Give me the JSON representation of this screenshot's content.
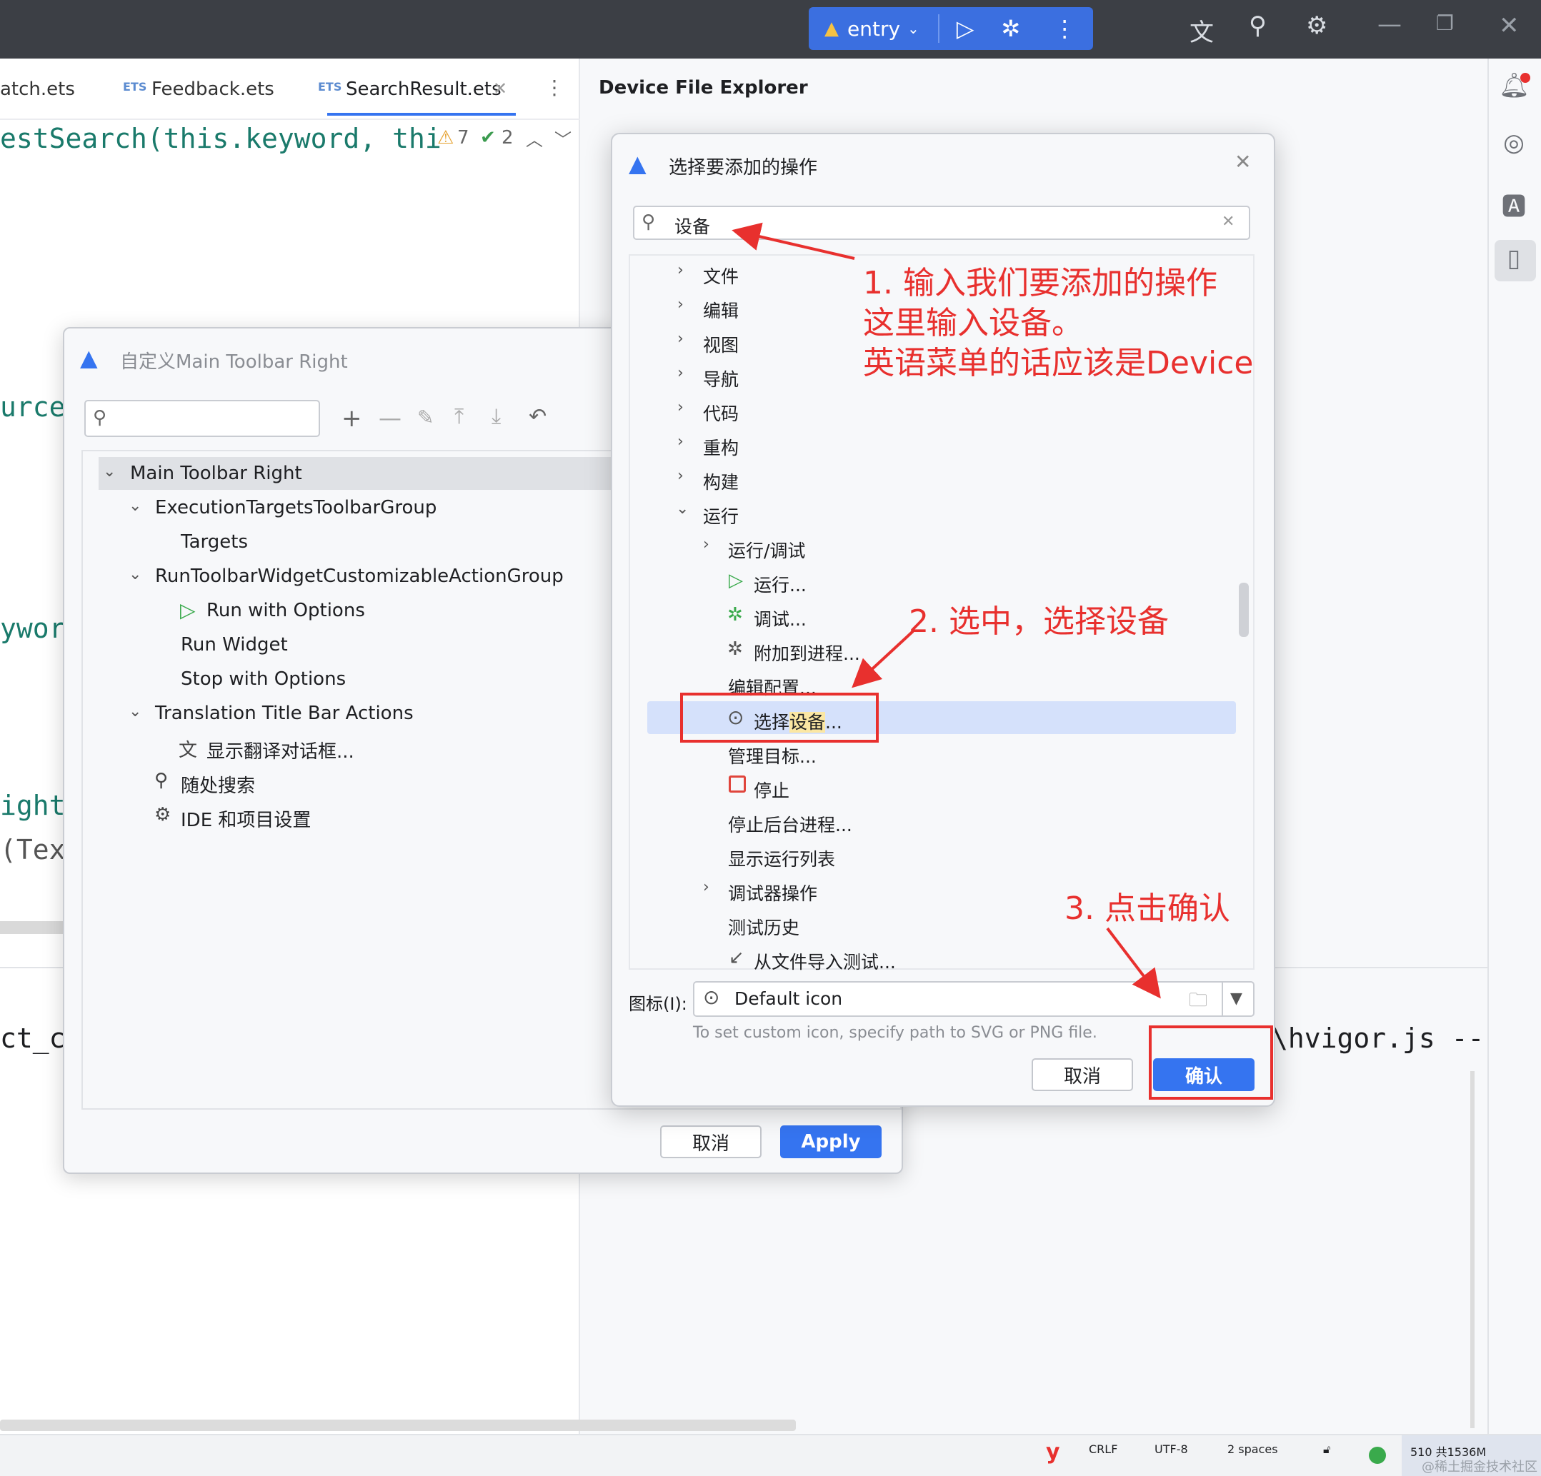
{
  "titlebar": {
    "run_config": "entry"
  },
  "editor": {
    "tabs": [
      "atch.ets",
      "Feedback.ets",
      "SearchResult.ets"
    ],
    "code_line_1": "estSearch(this.keyword, thi",
    "warnings": "7",
    "checks": "2",
    "fragments": [
      "urce",
      "ywor",
      "ight",
      "(Tex",
      "ct_c",
      "\\hvigor.js --"
    ]
  },
  "tool_window": {
    "title": "Device File Explorer"
  },
  "customize_dialog": {
    "title": "自定义Main Toolbar Right",
    "tree": [
      {
        "label": "Main Toolbar Right",
        "level": 0
      },
      {
        "label": "ExecutionTargetsToolbarGroup",
        "level": 1
      },
      {
        "label": "Targets",
        "level": 2
      },
      {
        "label": "RunToolbarWidgetCustomizableActionGroup",
        "level": 1
      },
      {
        "label": "Run with Options",
        "level": 2
      },
      {
        "label": "Run Widget",
        "level": 2
      },
      {
        "label": "Stop with Options",
        "level": 2
      },
      {
        "label": "Translation Title Bar Actions",
        "level": 1
      },
      {
        "label": "显示翻译对话框...",
        "level": 2
      },
      {
        "label": "随处搜索",
        "level": 1
      },
      {
        "label": "IDE 和项目设置",
        "level": 1
      }
    ],
    "cancel_label": "取消",
    "apply_label": "Apply"
  },
  "action_dialog": {
    "title": "选择要添加的操作",
    "search_value": "设备",
    "tree": {
      "files": "文件",
      "edit": "编辑",
      "view": "视图",
      "navigate": "导航",
      "code": "代码",
      "refactor": "重构",
      "build": "构建",
      "run": "运行",
      "run_debug": "运行/调试",
      "run_action": "运行...",
      "debug_action": "调试...",
      "attach": "附加到进程...",
      "edit_config": "编辑配置...",
      "select_device_prefix": "选择",
      "select_device_highlight": "设备",
      "select_device_suffix": "...",
      "manage_targets": "管理目标...",
      "stop": "停止",
      "stop_background": "停止后台进程...",
      "show_running": "显示运行列表",
      "debugger_actions": "调试器操作",
      "test_history": "测试历史",
      "import_tests": "从文件导入测试..."
    },
    "icon_label": "图标(I):",
    "icon_value": "Default icon",
    "icon_hint": "To set custom icon, specify path to SVG or PNG file.",
    "cancel_label": "取消",
    "ok_label": "确认"
  },
  "annotations": {
    "step1_line1": "1. 输入我们要添加的操作",
    "step1_line2": "这里输入设备。",
    "step1_line3": "英语菜单的话应该是Device",
    "step2": "2. 选中，选择设备",
    "step3": "3. 点击确认"
  },
  "statusbar": {
    "line_sep": "CRLF",
    "encoding": "UTF-8",
    "indent": "2 spaces",
    "memory": "510 共1536M",
    "watermark": "@稀土掘金技术社区"
  },
  "colors": {
    "accent": "#3574f0",
    "annotation_red": "#e8302e",
    "selection": "#d5e1fb",
    "titlebar": "#3c3f45"
  }
}
